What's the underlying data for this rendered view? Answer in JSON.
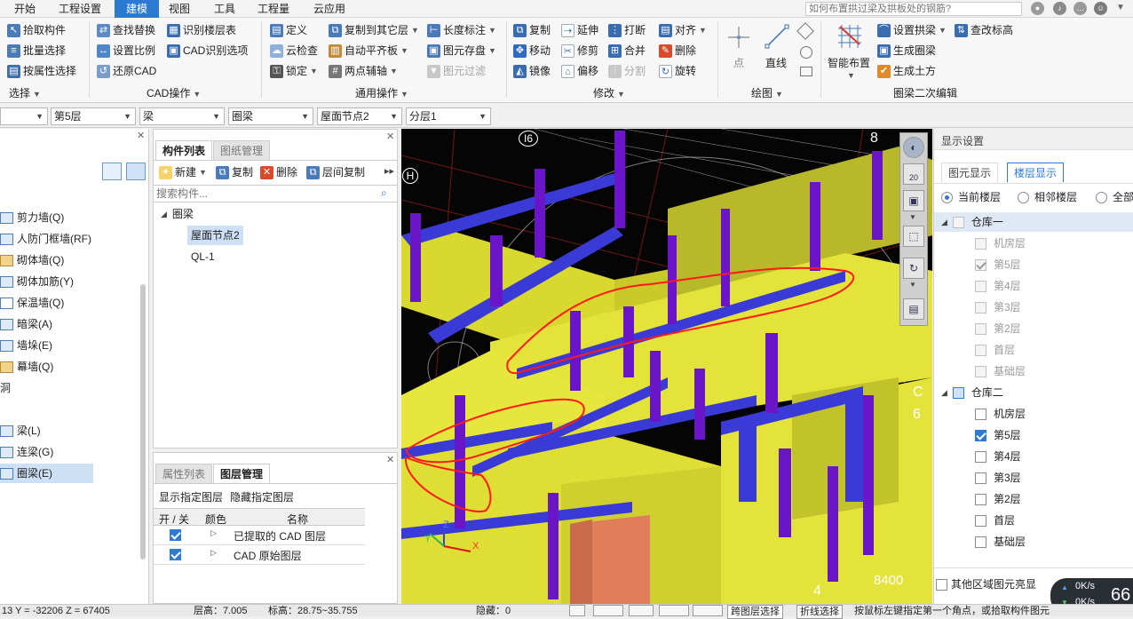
{
  "menu": {
    "tabs": [
      "开始",
      "工程设置",
      "建模",
      "视图",
      "工具",
      "工程量",
      "云应用"
    ],
    "active_tab": "建模",
    "search_placeholder": "如何布置拱过梁及拱板处的钢筋?"
  },
  "ribbon": {
    "select_group": {
      "label": "选择",
      "items": [
        "拾取构件",
        "批量选择",
        "按属性选择"
      ]
    },
    "cad_group": {
      "label": "CAD操作",
      "items": [
        "查找替换",
        "识别楼层表",
        "设置比例",
        "CAD识别选项",
        "还原CAD"
      ]
    },
    "general_group": {
      "label": "通用操作",
      "items": [
        "定义",
        "复制到其它层",
        "长度标注",
        "云检查",
        "自动平齐板",
        "图元存盘",
        "锁定",
        "两点辅轴",
        "图元过滤"
      ]
    },
    "modify_group": {
      "label": "修改",
      "items": [
        "复制",
        "延伸",
        "打断",
        "对齐",
        "移动",
        "修剪",
        "合并",
        "删除",
        "镜像",
        "偏移",
        "分割",
        "旋转"
      ]
    },
    "draw_group": {
      "label": "绘图",
      "items": [
        "点",
        "直线"
      ]
    },
    "ringbeam_group": {
      "label": "圈梁二次编辑",
      "items": [
        "智能布置",
        "设置拱梁",
        "查改标高",
        "生成圈梁",
        "生成土方"
      ]
    }
  },
  "selectors": [
    "",
    "第5层",
    "梁",
    "圈梁",
    "屋面节点2",
    "分层1"
  ],
  "nav_tree": {
    "items": [
      "剪力墙(Q)",
      "人防门框墙(RF)",
      "砌体墙(Q)",
      "砌体加筋(Y)",
      "保温墙(Q)",
      "暗梁(A)",
      "墙垛(E)",
      "幕墙(Q)",
      "洞",
      "梁(L)",
      "连梁(G)",
      "圈梁(E)"
    ],
    "selected": "圈梁(E)"
  },
  "component_panel": {
    "tabs": [
      "构件列表",
      "图纸管理"
    ],
    "toolbar": [
      "新建",
      "复制",
      "删除",
      "层间复制"
    ],
    "search_placeholder": "搜索构件...",
    "tree_root": "圈梁",
    "tree_items": [
      "屋面节点2",
      "QL-1"
    ],
    "selected": "屋面节点2"
  },
  "layer_panel": {
    "tabs": [
      "属性列表",
      "图层管理"
    ],
    "links": [
      "显示指定图层",
      "隐藏指定图层"
    ],
    "columns": [
      "开 / 关",
      "颜色",
      "名称"
    ],
    "rows": [
      {
        "on": true,
        "name": "已提取的 CAD 图层"
      },
      {
        "on": true,
        "name": "CAD 原始图层"
      }
    ]
  },
  "viewport": {
    "axis_labels": [
      "H",
      "I6",
      "8",
      "C",
      "6",
      "4",
      "8400"
    ],
    "axis_letters": {
      "x": "X",
      "y": "Y",
      "z": "Z"
    },
    "view_tool_label": "20"
  },
  "display_settings": {
    "title": "显示设置",
    "tabs": [
      "图元显示",
      "楼层显示"
    ],
    "active_tab": "楼层显示",
    "radio_options": [
      "当前楼层",
      "相邻楼层",
      "全部"
    ],
    "groups": [
      {
        "name": "仓库一",
        "checked": false,
        "floors": [
          {
            "name": "机房层",
            "checked": false
          },
          {
            "name": "第5层",
            "checked": true
          },
          {
            "name": "第4层",
            "checked": false
          },
          {
            "name": "第3层",
            "checked": false
          },
          {
            "name": "第2层",
            "checked": false
          },
          {
            "name": "首层",
            "checked": false
          },
          {
            "name": "基础层",
            "checked": false
          }
        ]
      },
      {
        "name": "仓库二",
        "checked": false,
        "floors": [
          {
            "name": "机房层",
            "checked": false
          },
          {
            "name": "第5层",
            "checked": true
          },
          {
            "name": "第4层",
            "checked": false
          },
          {
            "name": "第3层",
            "checked": false
          },
          {
            "name": "第2层",
            "checked": false
          },
          {
            "name": "首层",
            "checked": false
          },
          {
            "name": "基础层",
            "checked": false
          }
        ]
      }
    ],
    "highlight_option": "其他区域图元亮显"
  },
  "net_widget": {
    "up": "0K/s",
    "down": "0K/s",
    "percent": "66"
  },
  "status": {
    "coords": "13 Y = -32206 Z = 67405",
    "floor_height": "层高：7.005",
    "elevation": "标高：28.75~35.755",
    "hidden": "隐藏：0",
    "cross_layer": "跨图层选择",
    "polyline": "折线选择",
    "hint": "按鼠标左键指定第一个角点，或拾取构件图元"
  },
  "colors": {
    "accent": "#2b79d1",
    "wall": "#e3e33a",
    "beam": "#3a3ad6",
    "column": "#6b15c9",
    "annotation": "#e01010"
  }
}
